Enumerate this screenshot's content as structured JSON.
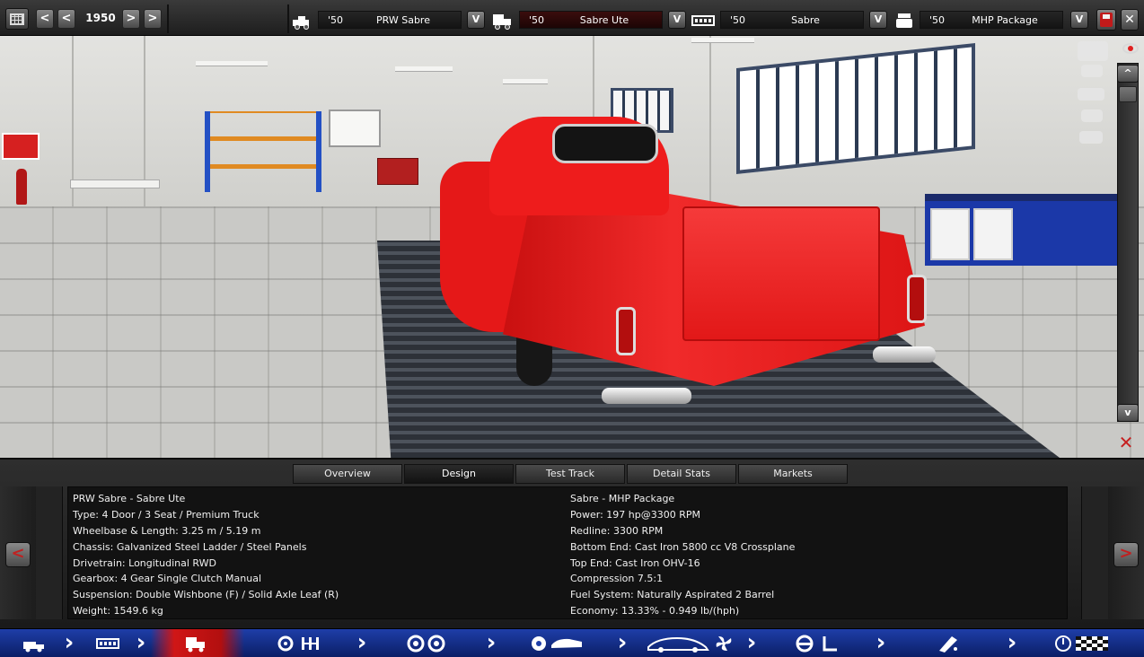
{
  "topbar": {
    "prev_year_fast": "<",
    "prev_year": "<",
    "year": "1950",
    "next_year": ">",
    "next_year_fast": ">",
    "selectors": [
      {
        "year": "'50",
        "name": "PRW Sabre",
        "dropdown": "V",
        "icon": "company-icon",
        "active": false
      },
      {
        "year": "'50",
        "name": "Sabre Ute",
        "dropdown": "V",
        "icon": "car-model-icon",
        "active": true
      },
      {
        "year": "'50",
        "name": "Sabre",
        "dropdown": "V",
        "icon": "engine-family-icon",
        "active": false
      },
      {
        "year": "'50",
        "name": "MHP Package",
        "dropdown": "V",
        "icon": "engine-variant-icon",
        "active": false
      }
    ],
    "close": "✕"
  },
  "view_controls": {
    "scroll_up": "^",
    "scroll_down": "v",
    "reset": "✕"
  },
  "tabs": [
    {
      "label": "Overview",
      "active": false
    },
    {
      "label": "Design",
      "active": true
    },
    {
      "label": "Test Track",
      "active": false
    },
    {
      "label": "Detail Stats",
      "active": false
    },
    {
      "label": "Markets",
      "active": false
    }
  ],
  "info": {
    "left": [
      "PRW Sabre - Sabre Ute",
      "Type: 4 Door / 3 Seat / Premium Truck",
      "Wheelbase & Length: 3.25 m / 5.19 m",
      "Chassis: Galvanized Steel Ladder / Steel Panels",
      "Drivetrain: Longitudinal RWD",
      "Gearbox: 4 Gear Single Clutch Manual",
      "Suspension: Double Wishbone (F) / Solid Axle Leaf (R)",
      "Weight: 1549.6 kg"
    ],
    "right": [
      "Sabre - MHP Package",
      "Power: 197 hp@3300 RPM",
      "Redline: 3300 RPM",
      "Bottom End: Cast Iron 5800 cc V8 Crossplane",
      "Top End: Cast Iron OHV-16",
      "Compression 7.5:1",
      "Fuel System: Naturally Aspirated 2 Barrel",
      "Economy: 13.33% - 0.949 lb/(hph)"
    ]
  },
  "side_nav": {
    "prev": "<",
    "next": ">"
  },
  "bottom_nav": [
    {
      "icon": "car-info-icon",
      "active": false
    },
    {
      "icon": "chassis-icon",
      "active": false
    },
    {
      "icon": "body-icon",
      "active": true
    },
    {
      "icon": "drivetrain-icon",
      "active": false
    },
    {
      "icon": "wheels-icon",
      "active": false
    },
    {
      "icon": "trim-icon",
      "active": false
    },
    {
      "icon": "aero-cooling-icon",
      "active": false
    },
    {
      "icon": "interior-icon",
      "active": false
    },
    {
      "icon": "exhaust-icon",
      "active": false
    },
    {
      "icon": "testing-finish-icon",
      "active": false
    }
  ],
  "colors": {
    "accent_red": "#d01616",
    "nav_blue": "#1e3ea8",
    "car_red": "#ee1c1c"
  }
}
